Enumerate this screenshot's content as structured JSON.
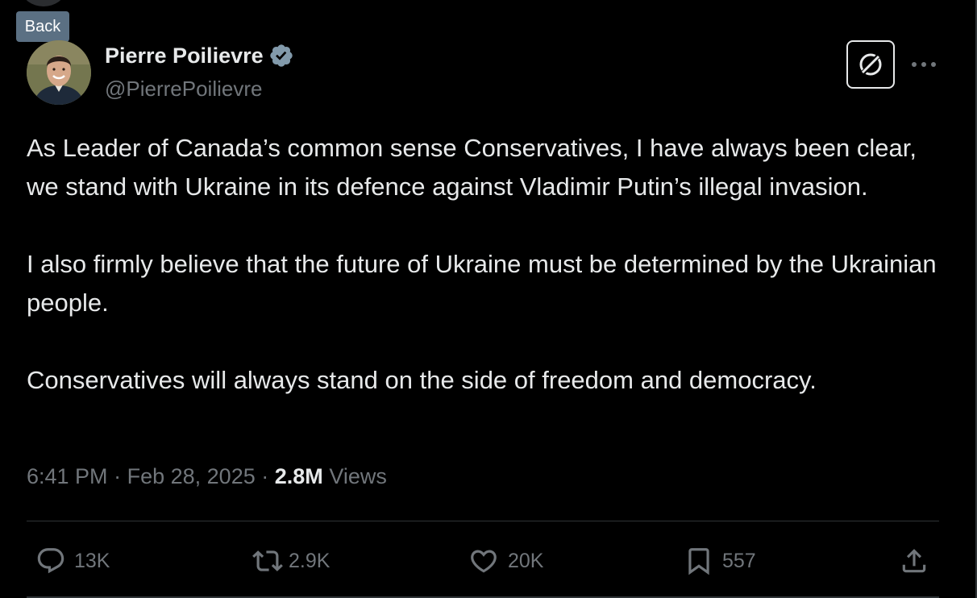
{
  "tooltip": {
    "back_label": "Back"
  },
  "author": {
    "name": "Pierre Poilievre",
    "handle": "@PierrePoilievre",
    "verified_icon": "verified-badge-icon",
    "verified_color": "#829aab"
  },
  "header_actions": {
    "grok_icon": "grok-icon",
    "more_icon": "more-horizontal-icon"
  },
  "tweet": {
    "paragraphs": [
      "As Leader of Canada’s common sense Conservatives, I have always been clear, we stand with Ukraine in its defence against Vladimir Putin’s illegal invasion.",
      "I also firmly believe that the future of Ukraine must be determined by the Ukrainian people.",
      "Conservatives will always stand on the side of freedom and democracy."
    ]
  },
  "meta": {
    "time": "6:41 PM",
    "separator": "·",
    "date": "Feb 28, 2025",
    "views_count": "2.8M",
    "views_label": "Views"
  },
  "actions": {
    "replies": {
      "icon": "reply-icon",
      "count": "13K"
    },
    "reposts": {
      "icon": "repost-icon",
      "count": "2.9K"
    },
    "likes": {
      "icon": "heart-icon",
      "count": "20K"
    },
    "bookmarks": {
      "icon": "bookmark-icon",
      "count": "557"
    },
    "share": {
      "icon": "share-icon"
    }
  },
  "colors": {
    "background": "#000000",
    "text_primary": "#e7e9ea",
    "text_secondary": "#71767b",
    "divider": "#2f3336",
    "tooltip_bg": "#5b7083"
  }
}
